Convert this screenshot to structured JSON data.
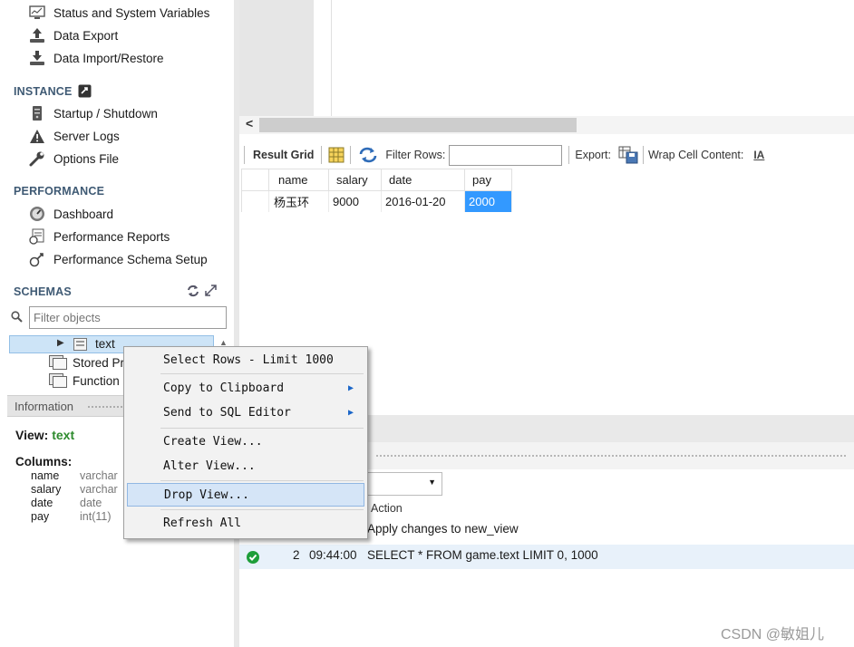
{
  "sidebar": {
    "management_items": [
      {
        "label": "Status and System Variables",
        "icon": "monitor-icon"
      },
      {
        "label": "Data Export",
        "icon": "export-icon"
      },
      {
        "label": "Data Import/Restore",
        "icon": "import-icon"
      }
    ],
    "instance": {
      "title": "INSTANCE",
      "items": [
        {
          "label": "Startup / Shutdown",
          "icon": "server-icon"
        },
        {
          "label": "Server Logs",
          "icon": "warning-icon"
        },
        {
          "label": "Options File",
          "icon": "wrench-icon"
        }
      ]
    },
    "performance": {
      "title": "PERFORMANCE",
      "items": [
        {
          "label": "Dashboard",
          "icon": "dashboard-icon"
        },
        {
          "label": "Performance Reports",
          "icon": "reports-icon"
        },
        {
          "label": "Performance Schema Setup",
          "icon": "schema-setup-icon"
        }
      ]
    },
    "schemas": {
      "title": "SCHEMAS",
      "filter_placeholder": "Filter objects",
      "tree_selected": "text",
      "tree_items": [
        "Stored Pr",
        "Function"
      ]
    },
    "information": {
      "tab_label": "Information",
      "view_label": "View:",
      "view_name": "text",
      "columns_label": "Columns:",
      "columns": [
        {
          "name": "name",
          "type": "varchar"
        },
        {
          "name": "salary",
          "type": "varchar"
        },
        {
          "name": "date",
          "type": "date"
        },
        {
          "name": "pay",
          "type": "int(11)"
        }
      ]
    }
  },
  "toolbar": {
    "result_grid": "Result Grid",
    "filter_rows": "Filter Rows:",
    "export": "Export:",
    "wrap_cell": "Wrap Cell Content:"
  },
  "grid": {
    "headers": [
      "name",
      "salary",
      "date",
      "pay"
    ],
    "rows": [
      [
        "杨玉环",
        "9000",
        "2016-01-20",
        "2000"
      ]
    ]
  },
  "output": {
    "action_header": "Action",
    "row1_action": "Apply changes to new_view",
    "row2_num": "2",
    "row2_time": "09:44:00",
    "row2_action": "SELECT * FROM game.text LIMIT 0, 1000"
  },
  "context_menu": {
    "items": [
      {
        "label": "Select Rows - Limit 1000"
      },
      {
        "label": "Copy to Clipboard",
        "sub": "▶"
      },
      {
        "label": "Send to SQL Editor",
        "sub": "▶"
      },
      {
        "label": "Create View..."
      },
      {
        "label": "Alter View..."
      },
      {
        "label": "Drop View..."
      },
      {
        "label": "Refresh All"
      }
    ]
  },
  "watermark": "CSDN @敏姐儿",
  "colors": {
    "section_title": "#3f5a74",
    "selection": "#3399ff",
    "menu_highlight": "#d5e5f7",
    "view_name": "#2e8b2e",
    "success": "#1e9e3a"
  }
}
